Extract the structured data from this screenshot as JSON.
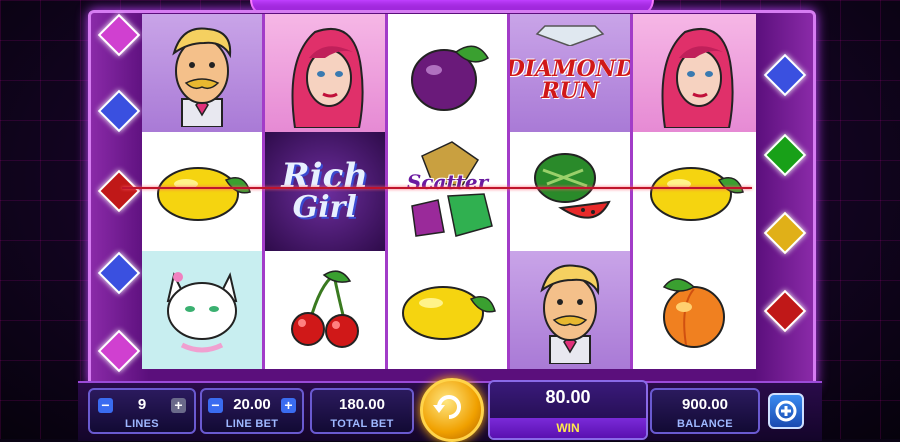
{
  "reels": {
    "symbols": [
      {
        "name": "man-symbol"
      },
      {
        "name": "woman-symbol"
      },
      {
        "name": "plum-symbol"
      },
      {
        "name": "diamond-run-symbol",
        "line1": "DIAMOND",
        "line2": "RUN"
      },
      {
        "name": "woman-symbol"
      },
      {
        "name": "lemon-symbol"
      },
      {
        "name": "rich-girl-symbol",
        "line1": "Rich",
        "line2": "Girl"
      },
      {
        "name": "scatter-symbol",
        "label": "Scatter"
      },
      {
        "name": "watermelon-symbol"
      },
      {
        "name": "lemon-symbol"
      },
      {
        "name": "cat-symbol"
      },
      {
        "name": "cherries-symbol"
      },
      {
        "name": "lemon-symbol"
      },
      {
        "name": "man-symbol"
      },
      {
        "name": "peach-symbol"
      }
    ]
  },
  "payline_markers": {
    "left": [
      "#d040d0",
      "#3a50e0",
      "#c01818",
      "#3a50e0",
      "#d040d0"
    ],
    "right": [
      "#3a50e0",
      "#18a018",
      "#e0b018",
      "#c01818"
    ]
  },
  "controls": {
    "lines": {
      "value": "9",
      "label": "LINES",
      "minus": "−",
      "plus": "+"
    },
    "line_bet": {
      "value": "20.00",
      "label": "LINE BET",
      "minus": "−",
      "plus": "+"
    },
    "total_bet": {
      "value": "180.00",
      "label": "TOTAL BET"
    },
    "win": {
      "value": "80.00",
      "label": "WIN"
    },
    "balance": {
      "value": "900.00",
      "label": "BALANCE"
    }
  },
  "icons": {
    "spin": "spin-refresh-icon",
    "menu": "settings-menu-icon"
  }
}
